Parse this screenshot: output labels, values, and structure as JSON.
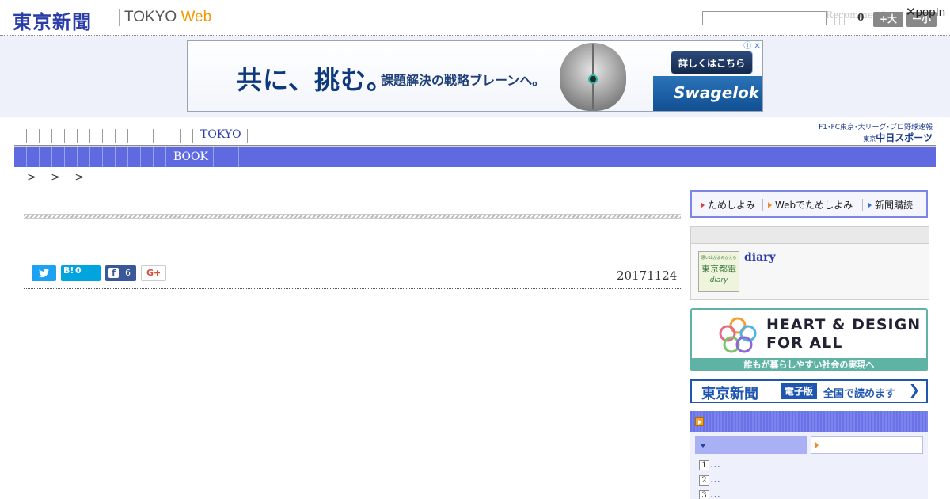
{
  "header": {
    "logo_kanji": "東京新聞",
    "logo_web_prefix": "TOKYO",
    "logo_web_suffix": "Web",
    "search_placeholder": "",
    "recommend_text": "Recommend",
    "count": "0",
    "font_large_label": "+大",
    "font_small_label": "ー小",
    "popin_label": "✕popIn"
  },
  "ad": {
    "headline": "共に、挑む。",
    "sub": "課題解決の戦略ブレーンへ。",
    "cta": "詳しくはこちら",
    "brand": "Swagelok",
    "corner": "ⓘ ✕"
  },
  "nav_primary": {
    "tokyo_label": "TOKYO"
  },
  "chunichi": {
    "top_text": "F1･FC東京･大リーグ･プロ野球速報",
    "bottom_prefix": "東京",
    "bottom_text": "中日スポーツ"
  },
  "nav_secondary": {
    "book_label": "BOOK"
  },
  "breadcrumb": {
    "text": "> > >"
  },
  "article": {
    "date": "20171124",
    "hatena_label": "B!",
    "hatena_count": "0",
    "facebook_count": "6",
    "gplus_label": "G+"
  },
  "sidebar": {
    "links": [
      {
        "label": "ためしよみ",
        "color": "#e03b3b"
      },
      {
        "label": "Webでためしよみ",
        "color": "#f08a24"
      },
      {
        "label": "新聞購読",
        "color": "#3a6ed6"
      }
    ],
    "diary": {
      "link": "diary",
      "thumb_line1": "思い出がよみがえる",
      "thumb_line2": "東京都電",
      "thumb_line3": "diary"
    },
    "heart_design": {
      "title_line1": "HEART & DESIGN",
      "title_line2": "FOR ALL",
      "strip": "誰もが暮らしやすい社会の実現へ"
    },
    "denshi": {
      "logo": "東京新聞",
      "badge": "電子版",
      "text": "全国で読めます",
      "arrow": "❯"
    },
    "ranking": {
      "items": [
        {
          "num": "1",
          "text": "…"
        },
        {
          "num": "2",
          "text": "…"
        },
        {
          "num": "3",
          "text": "…"
        }
      ]
    }
  },
  "colors": {
    "brand_blue": "#2b3ea8",
    "nav_bar": "#5f6ae0",
    "accent_orange": "#f39800",
    "twitter": "#1da1f2",
    "hatena": "#00a4de",
    "facebook": "#3b5998"
  }
}
